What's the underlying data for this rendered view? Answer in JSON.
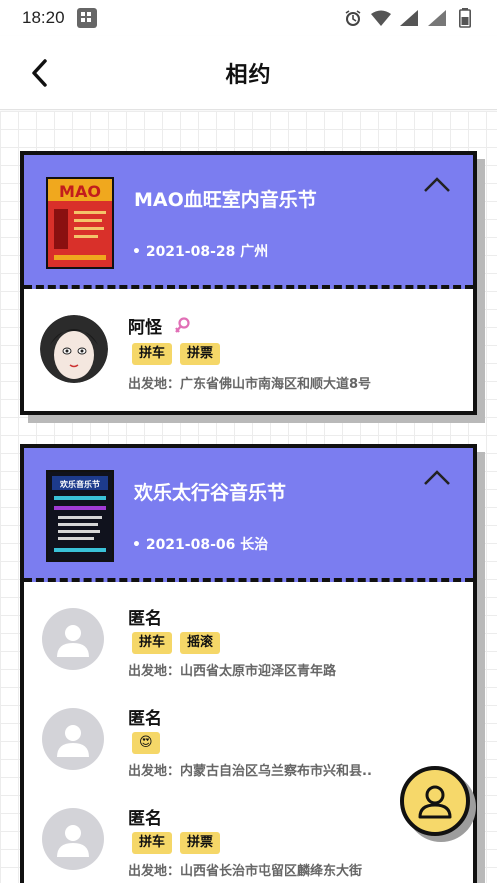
{
  "status": {
    "time": "18:20"
  },
  "header": {
    "title": "相约"
  },
  "events": [
    {
      "title": "MAO血旺室内音乐节",
      "meta": "• 2021-08-28 广州",
      "poster_text": "MAO",
      "people": [
        {
          "name": "阿怪",
          "tags": [
            "拼车",
            "拼票"
          ],
          "departure": "出发地：广东省佛山市南海区和顺大道8号"
        }
      ]
    },
    {
      "title": "欢乐太行谷音乐节",
      "meta": "• 2021-08-06 长治",
      "poster_text": "欢乐音乐节",
      "people": [
        {
          "name": "匿名",
          "tags": [
            "拼车",
            "摇滚"
          ],
          "departure": "出发地：山西省太原市迎泽区青年路"
        },
        {
          "name": "匿名",
          "tags": [
            "😍"
          ],
          "departure": "出发地：内蒙古自治区乌兰察布市兴和县.."
        },
        {
          "name": "匿名",
          "tags": [
            "拼车",
            "拼票"
          ],
          "departure": "出发地：山西省长治市屯留区麟绛东大街"
        }
      ]
    }
  ],
  "colors": {
    "card_head": "#7b7df0",
    "tag": "#f5d768",
    "fab": "#f6d86a"
  },
  "icons": [
    "back-icon",
    "chevron-up-icon",
    "female-icon",
    "user-icon",
    "alarm-icon",
    "wifi-icon",
    "signal-icon",
    "battery-icon"
  ]
}
